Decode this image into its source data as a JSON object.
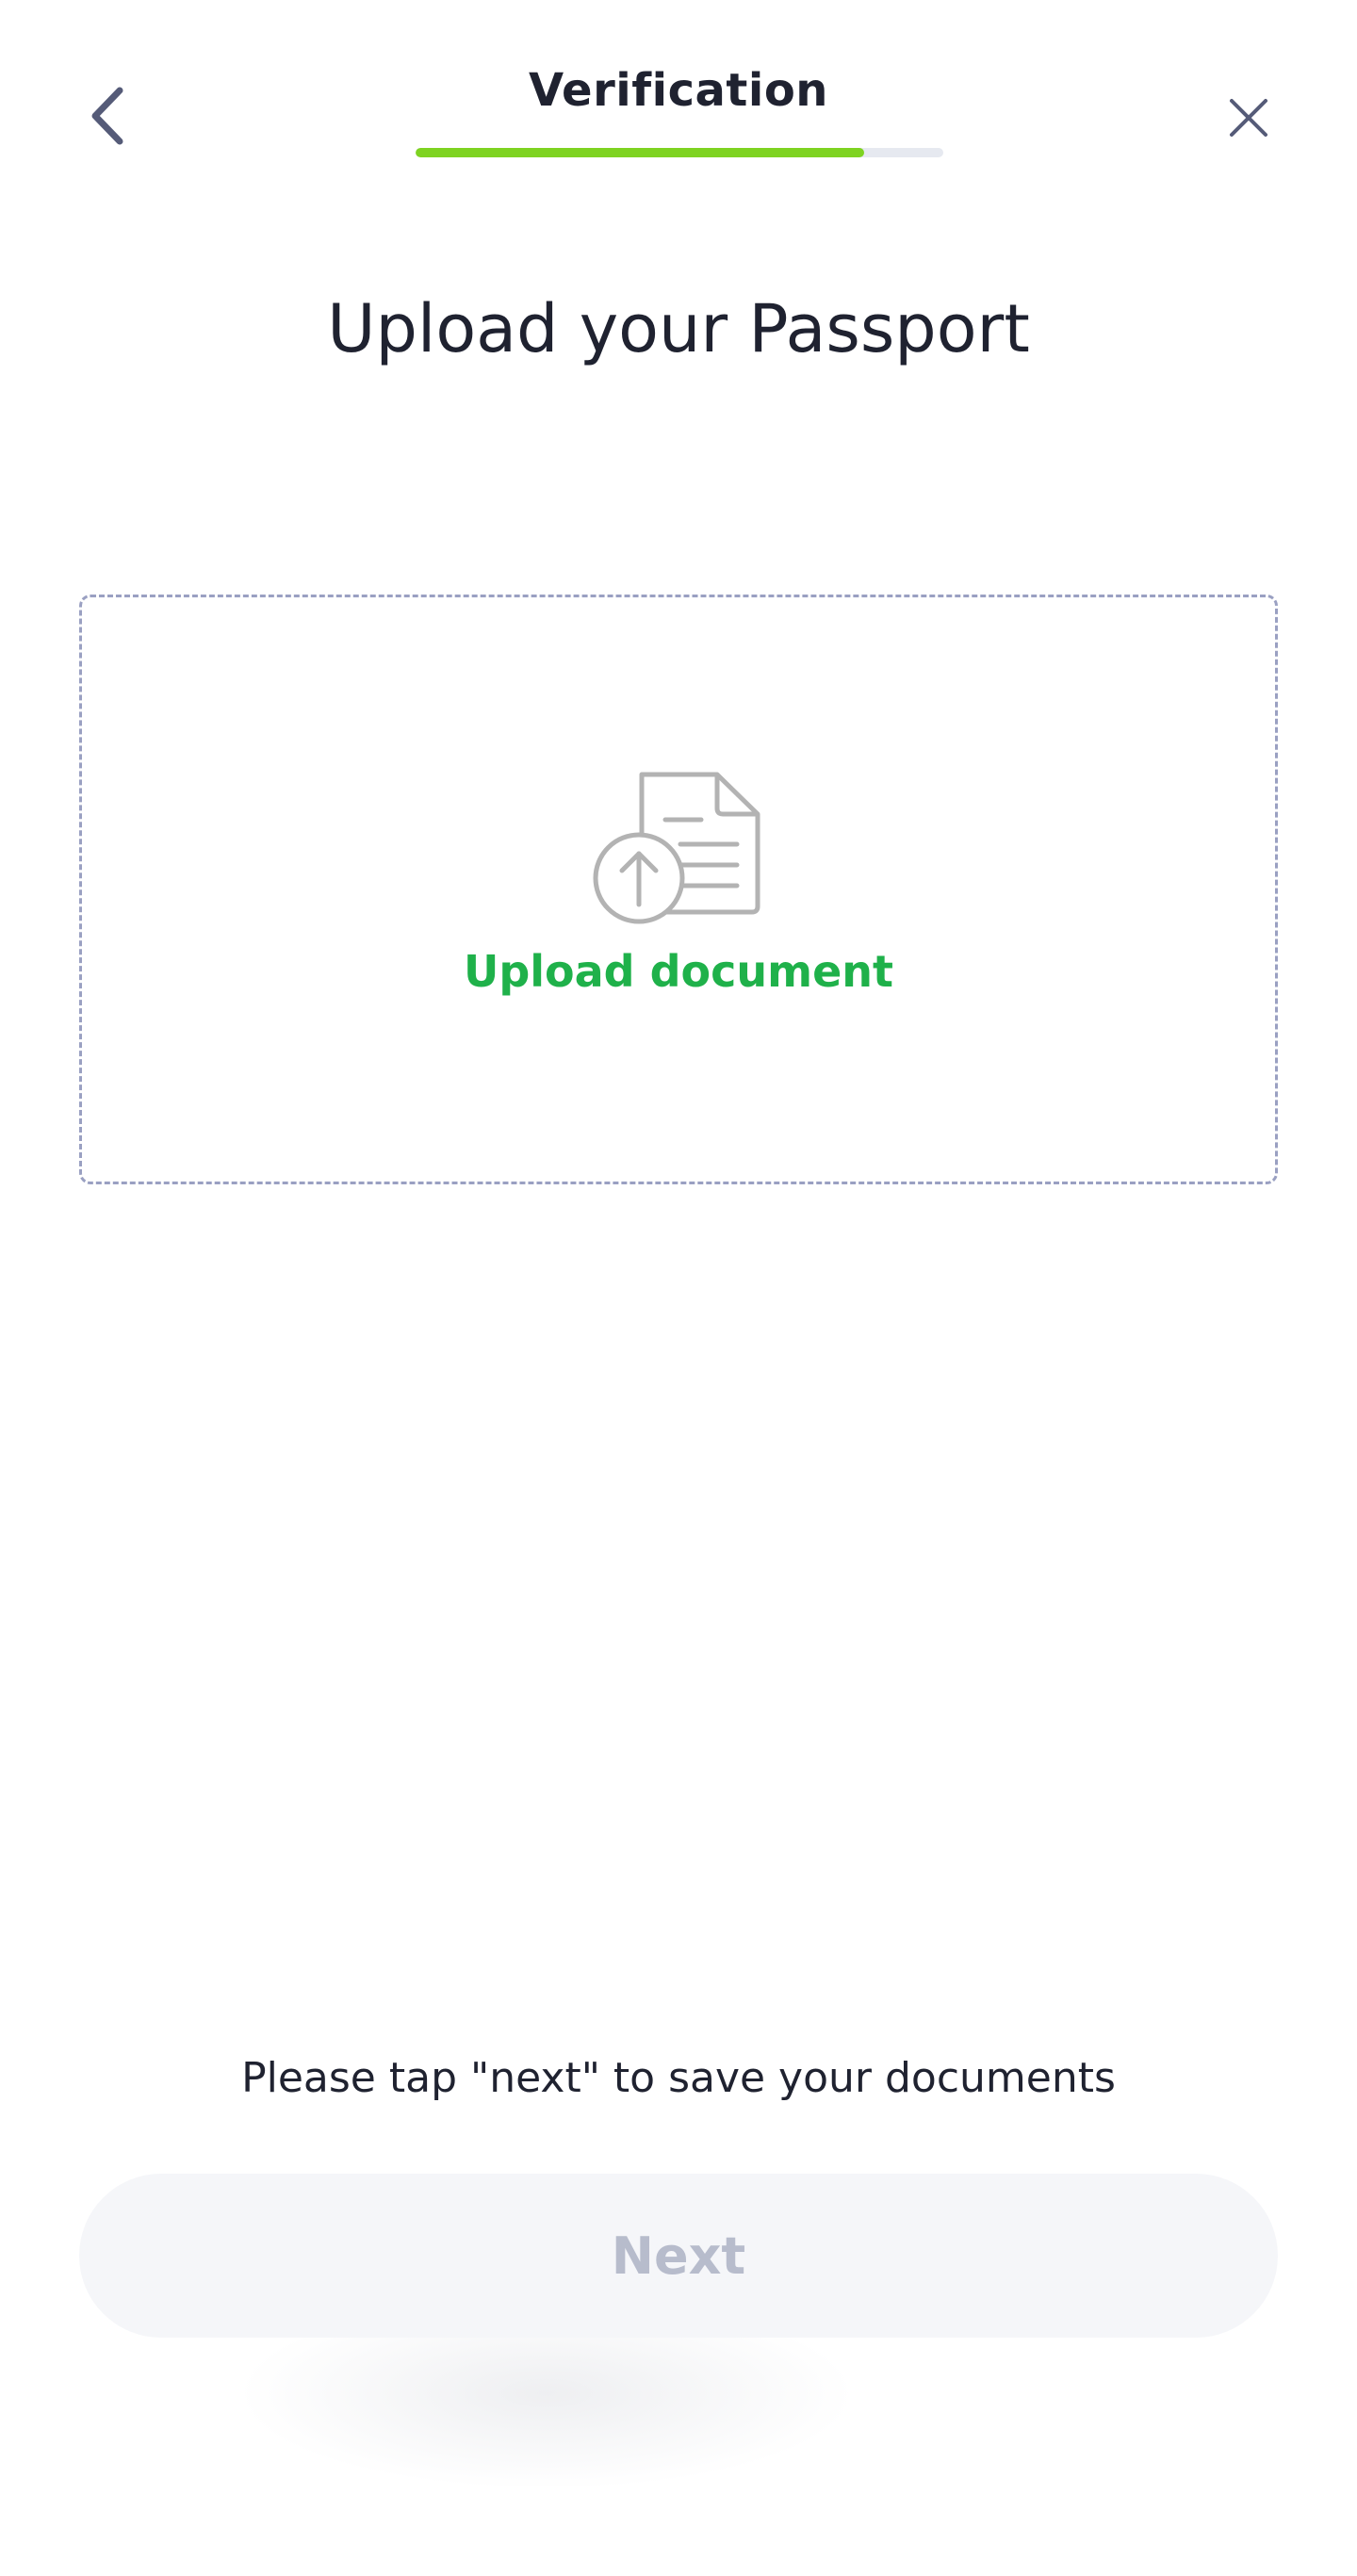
{
  "header": {
    "title": "Verification",
    "progress_fraction": 0.85,
    "back_icon": "chevron-left-icon",
    "close_icon": "close-icon"
  },
  "page": {
    "title": "Upload your Passport"
  },
  "upload": {
    "icon": "document-upload-icon",
    "label": "Upload document"
  },
  "footer": {
    "hint": "Please tap \"next\" to save your documents",
    "next_label": "Next",
    "next_disabled": true
  },
  "colors": {
    "accent_green": "#1fb14a",
    "progress_green": "#7ed321",
    "text_dark": "#1f2230",
    "disabled_text": "#b7bccc",
    "disabled_bg": "#f5f6f9"
  }
}
